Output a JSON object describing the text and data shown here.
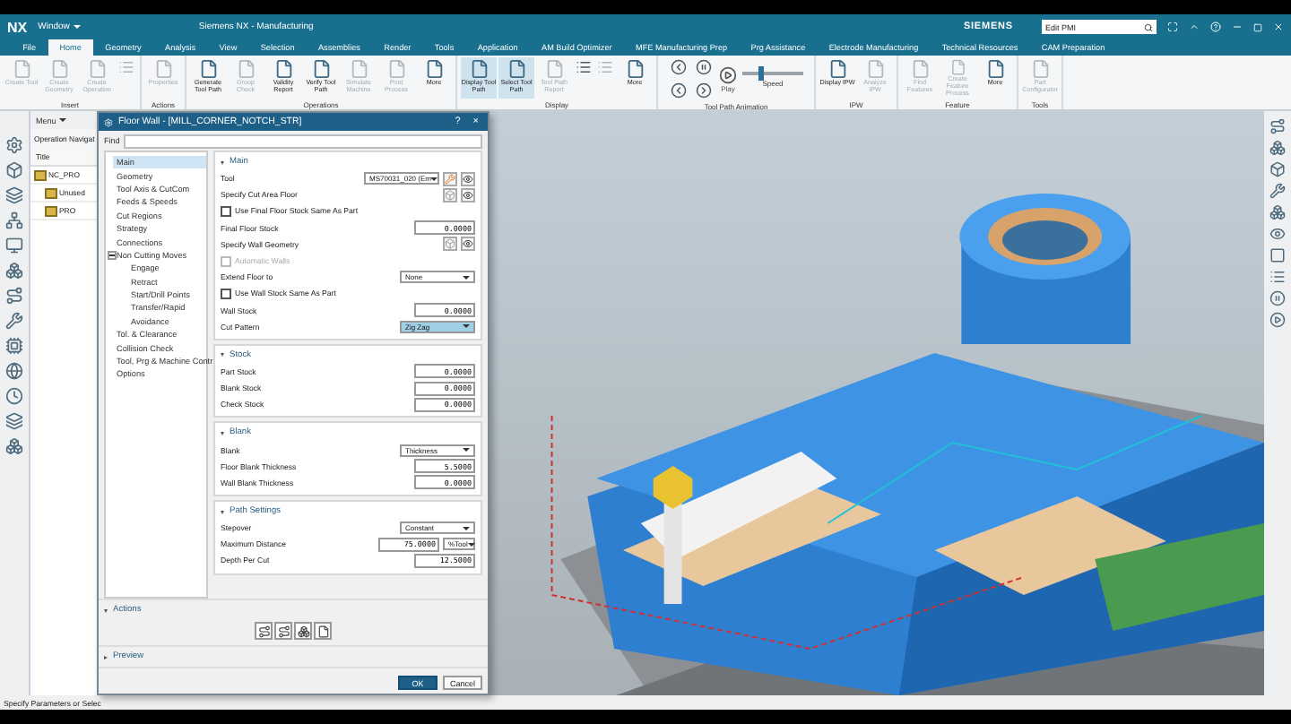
{
  "window": {
    "quick_access": "Window",
    "title": "Siemens NX - Manufacturing",
    "brand": "SIEMENS",
    "search": {
      "value": "Edit PMI"
    },
    "app": "NX"
  },
  "tabs": [
    {
      "label": "File",
      "selected": false
    },
    {
      "label": "Home",
      "selected": true
    },
    {
      "label": "Geometry",
      "selected": false
    },
    {
      "label": "Analysis",
      "selected": false
    },
    {
      "label": "View",
      "selected": false
    },
    {
      "label": "Selection",
      "selected": false
    },
    {
      "label": "Assemblies",
      "selected": false
    },
    {
      "label": "Render",
      "selected": false
    },
    {
      "label": "Tools",
      "selected": false
    },
    {
      "label": "Application",
      "selected": false
    },
    {
      "label": "AM Build Optimizer",
      "selected": false
    },
    {
      "label": "MFE Manufacturing Prep",
      "selected": false
    },
    {
      "label": "Prg Assistance",
      "selected": false
    },
    {
      "label": "Electrode Manufacturing",
      "selected": false
    },
    {
      "label": "Technical Resources",
      "selected": false
    },
    {
      "label": "CAM Preparation",
      "selected": false
    }
  ],
  "ribbon": {
    "groups": [
      {
        "label": "Insert",
        "items": [
          {
            "kind": "button",
            "label": "Create Tool",
            "disabled": true,
            "active": false
          },
          {
            "kind": "button",
            "label": "Create Geometry",
            "disabled": true,
            "active": false
          },
          {
            "kind": "button",
            "label": "Create Operation",
            "disabled": true,
            "active": false
          },
          {
            "kind": "icon",
            "disabled": true,
            "active": false
          }
        ]
      },
      {
        "label": "Actions",
        "items": [
          {
            "kind": "button",
            "label": "Properties",
            "disabled": true,
            "active": false
          }
        ]
      },
      {
        "label": "Operations",
        "items": [
          {
            "kind": "button",
            "label": "Generate Tool Path",
            "disabled": false,
            "active": false
          },
          {
            "kind": "button",
            "label": "Group Check",
            "disabled": true,
            "active": false
          },
          {
            "kind": "button",
            "label": "Validity Report",
            "disabled": false,
            "active": false
          },
          {
            "kind": "button",
            "label": "Verify Tool Path",
            "disabled": false,
            "active": false
          },
          {
            "kind": "button",
            "label": "Simulate Machine",
            "disabled": true,
            "active": false
          },
          {
            "kind": "button",
            "label": "Post Process",
            "disabled": true,
            "active": false
          },
          {
            "kind": "button",
            "label": "More",
            "disabled": false,
            "active": false
          }
        ]
      },
      {
        "label": "Display",
        "items": [
          {
            "kind": "button",
            "label": "Display Tool Path",
            "disabled": false,
            "active": true
          },
          {
            "kind": "button",
            "label": "Select Tool Path",
            "disabled": false,
            "active": true
          },
          {
            "kind": "button",
            "label": "Tool Path Report",
            "disabled": true,
            "active": false
          },
          {
            "kind": "icon",
            "disabled": false,
            "active": false
          },
          {
            "kind": "icon",
            "disabled": true,
            "active": false
          },
          {
            "kind": "button",
            "label": "More",
            "disabled": false,
            "active": false
          }
        ]
      },
      {
        "label": "Tool Path Animation",
        "kind": "animation",
        "play": "Play",
        "speed": {
          "label": "Speed",
          "level": 0.25
        }
      },
      {
        "label": "IPW",
        "items": [
          {
            "kind": "button",
            "label": "Display IPW",
            "disabled": false,
            "active": false
          },
          {
            "kind": "button",
            "label": "Analyze IPW",
            "disabled": true,
            "active": false
          }
        ]
      },
      {
        "label": "Feature",
        "items": [
          {
            "kind": "button",
            "label": "Find Features",
            "disabled": true,
            "active": false
          },
          {
            "kind": "button",
            "label": "Create Feature Process",
            "disabled": true,
            "active": false
          },
          {
            "kind": "button",
            "label": "More",
            "disabled": false,
            "active": false
          }
        ]
      },
      {
        "label": "Tools",
        "items": [
          {
            "kind": "button",
            "label": "Part Configurator",
            "disabled": true,
            "active": false
          }
        ]
      }
    ]
  },
  "navigator": {
    "menu": "Menu",
    "title": "Operation Navigat",
    "column": "Title",
    "tree": [
      {
        "label": "NC_PRO",
        "children": [
          {
            "label": "Unused"
          },
          {
            "label": "PRO"
          }
        ]
      }
    ]
  },
  "dialog": {
    "title": "Floor Wall - [MILL_CORNER_NOTCH_STR]",
    "help": "?",
    "close": "×",
    "find": "Find",
    "tree": [
      {
        "label": "Main",
        "selected": true
      },
      {
        "label": "Geometry",
        "selected": false
      },
      {
        "label": "Tool Axis & CutCom",
        "selected": false
      },
      {
        "label": "Feeds & Speeds",
        "selected": false
      },
      {
        "label": "Cut Regions",
        "selected": false
      },
      {
        "label": "Strategy",
        "selected": false
      },
      {
        "label": "Connections",
        "selected": false
      },
      {
        "label": "Non Cutting Moves",
        "selected": false,
        "expanded": true,
        "children": [
          {
            "label": "Engage",
            "selected": false
          },
          {
            "label": "Retract",
            "selected": false
          },
          {
            "label": "Start/Drill Points",
            "selected": false
          },
          {
            "label": "Transfer/Rapid",
            "selected": false
          },
          {
            "label": "Avoidance",
            "selected": false
          }
        ]
      },
      {
        "label": "Tol. & Clearance",
        "selected": false
      },
      {
        "label": "Collision Check",
        "selected": false
      },
      {
        "label": "Tool, Prg & Machine Contr",
        "selected": false
      },
      {
        "label": "Options",
        "selected": false
      }
    ],
    "sections": [
      {
        "title": "Main",
        "expanded": true,
        "rows": [
          {
            "kind": "tool",
            "label": "Tool",
            "value": "MS70031_020 (Em"
          },
          {
            "kind": "select",
            "label": "Specify Cut Area Floor"
          },
          {
            "kind": "checkbox",
            "label": "Use Final Floor Stock Same As Part",
            "checked": false,
            "disabled": false
          },
          {
            "kind": "number",
            "label": "Final Floor Stock",
            "value": "0.0000"
          },
          {
            "kind": "select",
            "label": "Specify Wall Geometry"
          },
          {
            "kind": "checkbox",
            "label": "Automatic Walls",
            "checked": false,
            "disabled": true
          },
          {
            "kind": "dropdown",
            "label": "Extend Floor to",
            "value": "None"
          },
          {
            "kind": "checkbox",
            "label": "Use Wall Stock Same As Part",
            "checked": false,
            "disabled": false
          },
          {
            "kind": "number",
            "label": "Wall Stock",
            "value": "0.0000"
          },
          {
            "kind": "pattern",
            "label": "Cut Pattern",
            "value": "Zig Zag"
          }
        ]
      },
      {
        "title": "Stock",
        "expanded": true,
        "rows": [
          {
            "kind": "number",
            "label": "Part Stock",
            "value": "0.0000"
          },
          {
            "kind": "number",
            "label": "Blank Stock",
            "value": "0.0000"
          },
          {
            "kind": "number",
            "label": "Check Stock",
            "value": "0.0000"
          }
        ]
      },
      {
        "title": "Blank",
        "expanded": true,
        "rows": [
          {
            "kind": "dropdown",
            "label": "Blank",
            "value": "Thickness"
          },
          {
            "kind": "number",
            "label": "Floor Blank Thickness",
            "value": "5.5000"
          },
          {
            "kind": "number",
            "label": "Wall Blank Thickness",
            "value": "0.0000"
          }
        ]
      },
      {
        "title": "Path Settings",
        "expanded": true,
        "rows": [
          {
            "kind": "dropdown",
            "label": "Stepover",
            "value": "Constant"
          },
          {
            "kind": "unit",
            "label": "Maximum Distance",
            "value": "75.0000",
            "unit": "%Tool"
          },
          {
            "kind": "number",
            "label": "Depth Per Cut",
            "value": "12.5000"
          }
        ]
      }
    ],
    "actions": {
      "title": "Actions",
      "expanded": true
    },
    "preview": {
      "title": "Preview",
      "expanded": false
    },
    "buttons": [
      {
        "label": "OK",
        "kind": "primary"
      },
      {
        "label": "Cancel",
        "kind": "secondary"
      }
    ]
  },
  "status_bar": "Specify Parameters or Selec"
}
